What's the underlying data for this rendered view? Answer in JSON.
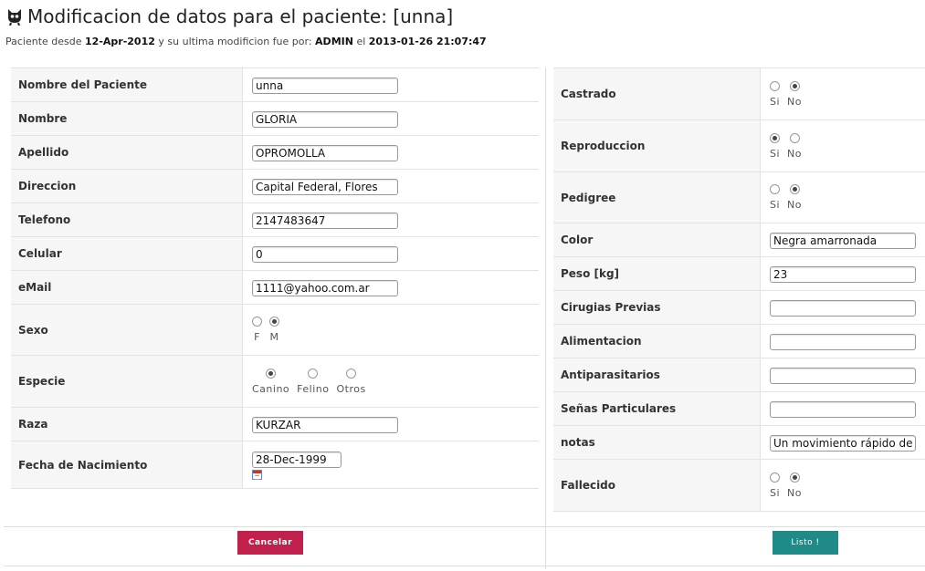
{
  "header": {
    "title": "Modificacion de datos para el paciente: [unna]",
    "subtitle_prefix": "Paciente desde",
    "since_date": "12-Apr-2012",
    "subtitle_mid": "y su ultima modificion fue por:",
    "modified_by": "ADMIN",
    "subtitle_el": "el",
    "modified_at": "2013-01-26 21:07:47"
  },
  "left": {
    "nombre_paciente": {
      "label": "Nombre del Paciente",
      "value": "unna"
    },
    "nombre": {
      "label": "Nombre",
      "value": "GLORIA"
    },
    "apellido": {
      "label": "Apellido",
      "value": "OPROMOLLA"
    },
    "direccion": {
      "label": "Direccion",
      "value": "Capital Federal, Flores"
    },
    "telefono": {
      "label": "Telefono",
      "value": "2147483647"
    },
    "celular": {
      "label": "Celular",
      "value": "0"
    },
    "email": {
      "label": "eMail",
      "value": "1111@yahoo.com.ar"
    },
    "sexo": {
      "label": "Sexo",
      "options": [
        "F",
        "M"
      ],
      "selected": "M"
    },
    "especie": {
      "label": "Especie",
      "options": [
        "Canino",
        "Felino",
        "Otros"
      ],
      "selected": "Canino"
    },
    "raza": {
      "label": "Raza",
      "value": "KURZAR"
    },
    "fecha_nacimiento": {
      "label": "Fecha de Nacimiento",
      "value": "28-Dec-1999"
    }
  },
  "right": {
    "castrado": {
      "label": "Castrado",
      "options": [
        "Si",
        "No"
      ],
      "selected": "No"
    },
    "reproduccion": {
      "label": "Reproduccion",
      "options": [
        "Si",
        "No"
      ],
      "selected": "Si"
    },
    "pedigree": {
      "label": "Pedigree",
      "options": [
        "Si",
        "No"
      ],
      "selected": "No"
    },
    "color": {
      "label": "Color",
      "value": "Negra amarronada"
    },
    "peso": {
      "label": "Peso [kg]",
      "value": "23"
    },
    "cirugias": {
      "label": "Cirugias Previas",
      "value": ""
    },
    "alimentacion": {
      "label": "Alimentacion",
      "value": ""
    },
    "antiparasitarios": {
      "label": "Antiparasitarios",
      "value": ""
    },
    "senas": {
      "label": "Señas Particulares",
      "value": ""
    },
    "notas": {
      "label": "notas",
      "value": "Un movimiento rápido de la"
    },
    "fallecido": {
      "label": "Fallecido",
      "options": [
        "Si",
        "No"
      ],
      "selected": "No"
    }
  },
  "buttons": {
    "cancel": "Cancelar",
    "ok": "Listo !"
  },
  "colors": {
    "cancel": "#c0204b",
    "ok": "#1f8a88"
  },
  "icons": {
    "logo": "cat-mascot-icon",
    "calendar": "calendar-icon"
  }
}
